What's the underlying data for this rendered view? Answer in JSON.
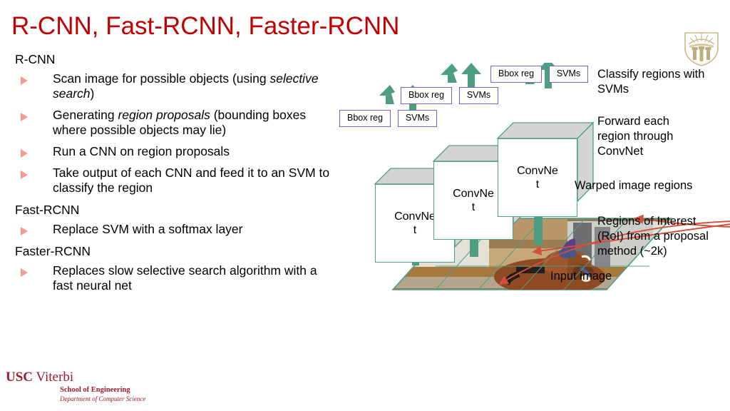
{
  "slide": {
    "title": "R-CNN, Fast-RCNN, Faster-RCNN",
    "title_color": "#c00000",
    "bullet_color": "#f79b92"
  },
  "sections": [
    {
      "heading": "R-CNN"
    },
    {
      "heading": "Fast-RCNN"
    },
    {
      "heading": "Faster-RCNN"
    }
  ],
  "bullets": {
    "b1_a": "Scan image for possible objects (using ",
    "b1_i": "selective search",
    "b1_b": ")",
    "b2_a": "Generating ",
    "b2_i": "region proposals",
    "b2_b": " (bounding boxes where possible objects may lie)",
    "b3": "Run a CNN on region proposals",
    "b4": "Take output of each CNN and feed it to an SVM to classify the region",
    "b5": "Replace SVM with a softmax layer",
    "b6": "Replaces slow selective search algorithm with a fast neural net"
  },
  "diagram": {
    "chips": [
      {
        "label": "Bbox reg"
      },
      {
        "label": "SVMs"
      },
      {
        "label": "Bbox reg"
      },
      {
        "label": "SVMs"
      },
      {
        "label": "Bbox reg"
      },
      {
        "label": "SVMs"
      }
    ],
    "cubes": [
      {
        "label": "ConvNet"
      },
      {
        "label": "ConvNet"
      },
      {
        "label": "ConvNet"
      }
    ],
    "notes": {
      "classify": "Classify regions with\nSVMs",
      "forward": "Forward each\nregion through\nConvNet",
      "warped": "Warped image regions",
      "roi": "Regions of Interest\n(RoI) from a proposal\nmethod (~2k)",
      "input": "Input image"
    },
    "colors": {
      "arrow_green": "#4d9e83",
      "box_border": "#4f9e86",
      "chip_border": "#7a5ec4",
      "roi_arrow_red": "#d1503c",
      "cube_side": "#d4d4d4"
    }
  },
  "footer": {
    "usc": "USC",
    "viterbi": " Viterbi",
    "school": "School of Engineering",
    "department": "Department of Computer Science",
    "color": "#9d1b28"
  }
}
